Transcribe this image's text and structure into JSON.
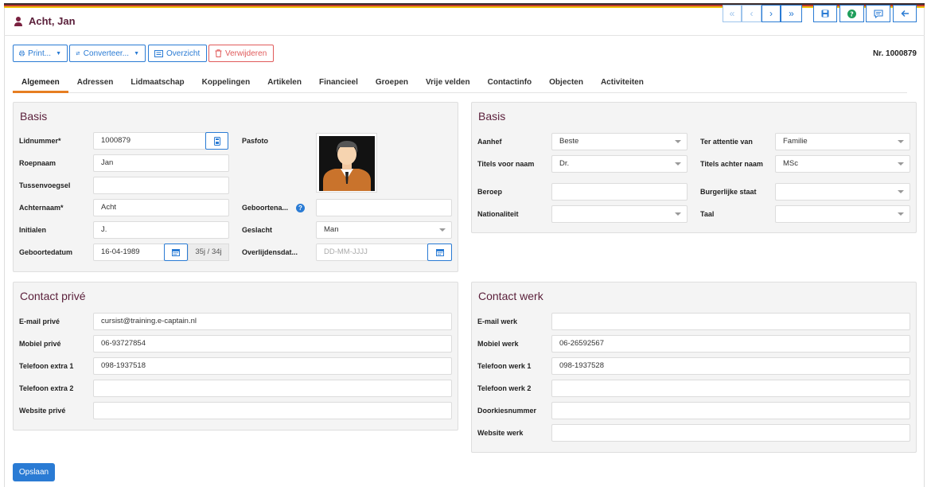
{
  "header": {
    "title": "Acht, Jan",
    "record_nr": "Nr. 1000879"
  },
  "nav": {
    "first": "«",
    "prev": "‹",
    "next": "›",
    "last": "»"
  },
  "toolbar": {
    "print": "Print...",
    "convert": "Converteer...",
    "overview": "Overzicht",
    "delete": "Verwijderen"
  },
  "tabs": [
    "Algemeen",
    "Adressen",
    "Lidmaatschap",
    "Koppelingen",
    "Artikelen",
    "Financieel",
    "Groepen",
    "Vrije velden",
    "Contactinfo",
    "Objecten",
    "Activiteiten"
  ],
  "basis_left": {
    "title": "Basis",
    "lidnummer_label": "Lidnummer*",
    "lidnummer": "1000879",
    "roepnaam_label": "Roepnaam",
    "roepnaam": "Jan",
    "tussenvoegsel_label": "Tussenvoegsel",
    "tussenvoegsel": "",
    "achternaam_label": "Achternaam*",
    "achternaam": "Acht",
    "initialen_label": "Initialen",
    "initialen": "J.",
    "geboortedatum_label": "Geboortedatum",
    "geboortedatum": "16-04-1989",
    "leeftijd": "35j / 34j",
    "pasfoto_label": "Pasfoto",
    "geboorteplaats_label": "Geboortena...",
    "geboorteplaats": "",
    "geslacht_label": "Geslacht",
    "geslacht": "Man",
    "overlijdensdatum_label": "Overlijdensdat...",
    "overlijdensdatum_placeholder": "DD-MM-JJJJ"
  },
  "basis_right": {
    "title": "Basis",
    "aanhef_label": "Aanhef",
    "aanhef": "Beste",
    "titels_voor_label": "Titels voor naam",
    "titels_voor": "Dr.",
    "beroep_label": "Beroep",
    "beroep": "",
    "nationaliteit_label": "Nationaliteit",
    "nationaliteit": "",
    "ter_attentie_label": "Ter attentie van",
    "ter_attentie": "Familie",
    "titels_achter_label": "Titels achter naam",
    "titels_achter": "MSc",
    "burgerlijke_staat_label": "Burgerlijke staat",
    "burgerlijke_staat": "",
    "taal_label": "Taal",
    "taal": ""
  },
  "contact_prive": {
    "title": "Contact privé",
    "email_label": "E-mail privé",
    "email": "cursist@training.e-captain.nl",
    "mobiel_label": "Mobiel privé",
    "mobiel": "06-93727854",
    "tel_extra1_label": "Telefoon extra 1",
    "tel_extra1": "098-1937518",
    "tel_extra2_label": "Telefoon extra 2",
    "tel_extra2": "",
    "website_label": "Website privé",
    "website": ""
  },
  "contact_werk": {
    "title": "Contact werk",
    "email_label": "E-mail werk",
    "email": "",
    "mobiel_label": "Mobiel werk",
    "mobiel": "06-26592567",
    "tel1_label": "Telefoon werk 1",
    "tel1": "098-1937528",
    "tel2_label": "Telefoon werk 2",
    "tel2": "",
    "doorkies_label": "Doorkiesnummer",
    "doorkies": "",
    "website_label": "Website werk",
    "website": ""
  },
  "footer": {
    "save": "Opslaan"
  },
  "colors": {
    "accent": "#2a7bd4",
    "title": "#5a1f3a",
    "tab_active": "#e67e22",
    "danger": "#e05a5a"
  }
}
